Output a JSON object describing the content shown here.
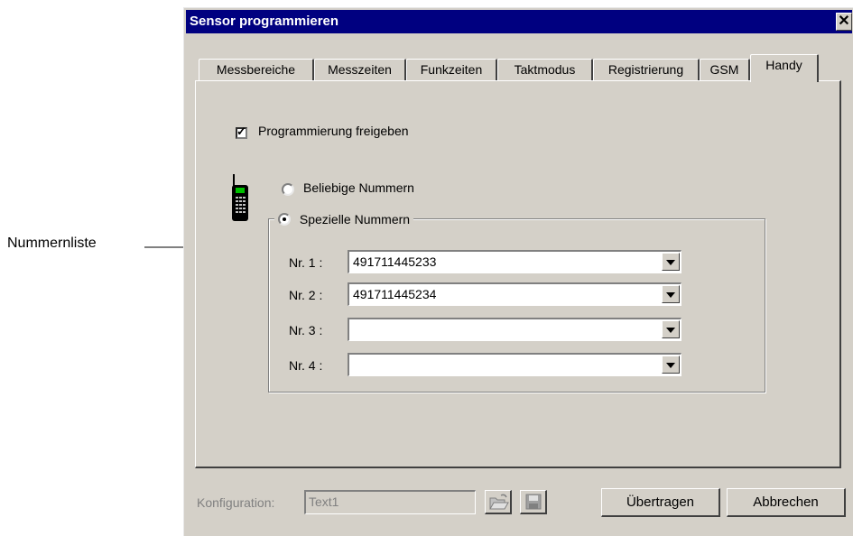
{
  "annotation": {
    "label": "Nummernliste"
  },
  "window": {
    "title": "Sensor programmieren",
    "close_glyph": "✕"
  },
  "tabs": [
    {
      "label": "Messbereiche"
    },
    {
      "label": "Messzeiten"
    },
    {
      "label": "Funkzeiten"
    },
    {
      "label": "Taktmodus"
    },
    {
      "label": "Registrierung"
    },
    {
      "label": "GSM"
    },
    {
      "label": "Handy",
      "active": true
    }
  ],
  "panel": {
    "enable_checkbox": {
      "label": "Programmierung freigeben",
      "checked": true
    },
    "phone_icon": "mobile-phone-icon",
    "radio_any": {
      "label": "Beliebige Nummern",
      "selected": false
    },
    "radio_special": {
      "label": "Spezielle Nummern",
      "selected": true
    },
    "numbers": [
      {
        "label": "Nr. 1 :",
        "value": "491711445233"
      },
      {
        "label": "Nr. 2 :",
        "value": "491711445234"
      },
      {
        "label": "Nr. 3 :",
        "value": ""
      },
      {
        "label": "Nr. 4 :",
        "value": ""
      }
    ]
  },
  "footer": {
    "config_label": "Konfiguration:",
    "config_value": "Text1",
    "open_icon": "open-folder-icon",
    "save_icon": "save-disk-icon",
    "transfer_button": "Übertragen",
    "cancel_button": "Abbrechen"
  },
  "colors": {
    "titlebar": "#000080",
    "face": "#d4d0c8",
    "phone_screen": "#00c000"
  }
}
